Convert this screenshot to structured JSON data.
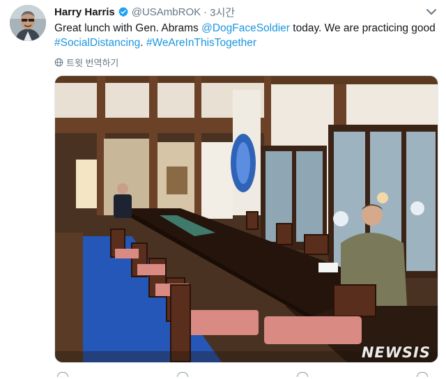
{
  "tweet": {
    "author_name": "Harry Harris",
    "handle": "@USAmbROK",
    "separator": "·",
    "time": "3시간",
    "text_intro": "Great lunch with Gen. Abrams ",
    "mention": "@DogFaceSoldier",
    "text_after_mention": " today. We are practicing good",
    "hashtag_1": "#SocialDistancing",
    "text_between_hashtags": ". ",
    "hashtag_2": "#WeAreInThisTogether",
    "translate_label": "트윗 번역하기"
  },
  "photo": {
    "watermark": "NEWSIS"
  },
  "colors": {
    "link": "#1b95e0",
    "verified": "#1da1f2",
    "secondary_text": "#657786"
  },
  "icons": [
    "verified-badge-icon",
    "chevron-down-icon",
    "globe-icon"
  ]
}
